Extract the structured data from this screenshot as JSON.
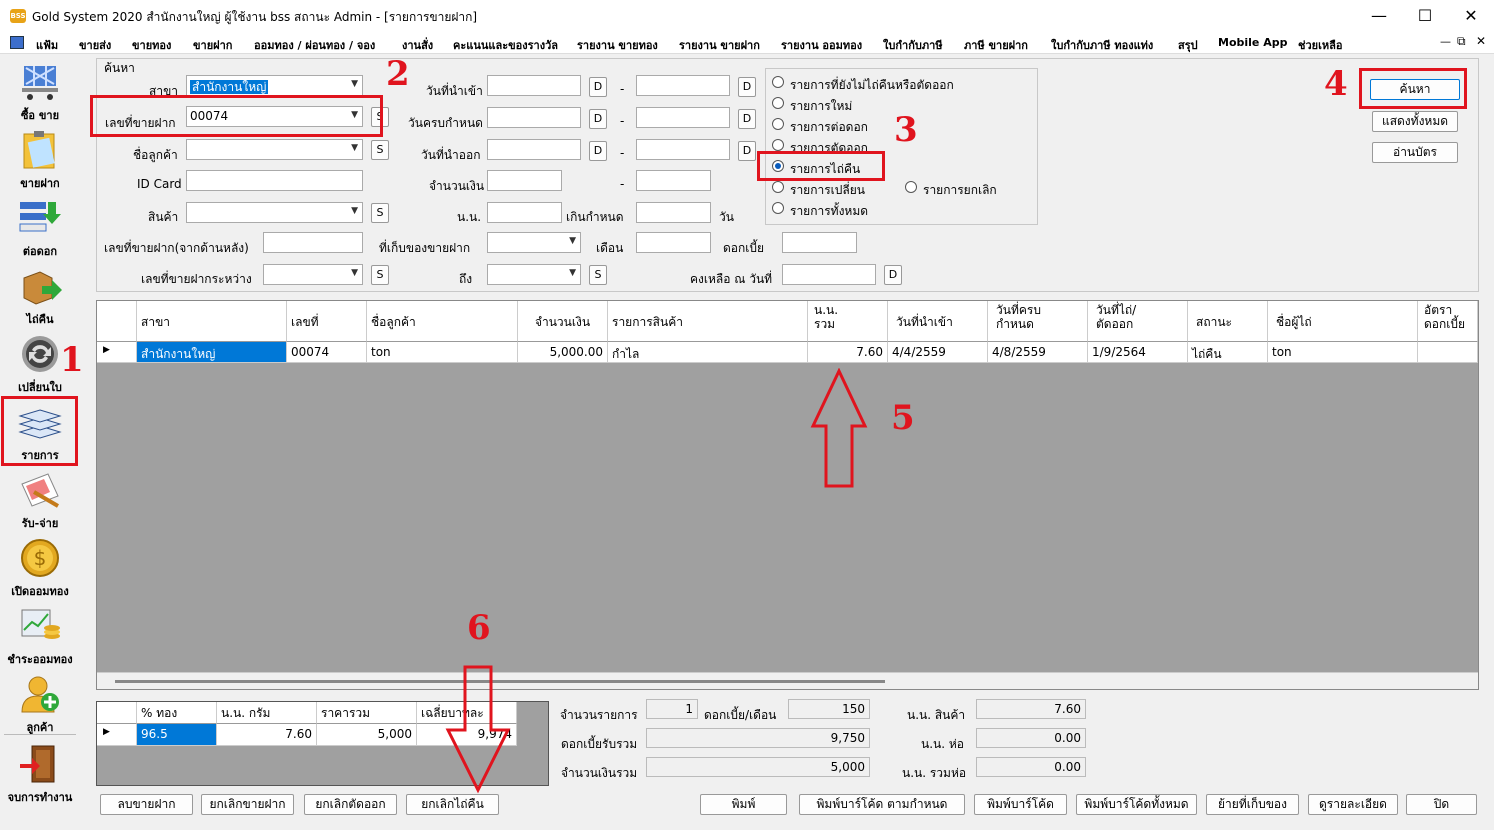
{
  "window": {
    "title": "Gold System 2020  สำนักงานใหญ่ ผู้ใช้งาน bss สถานะ Admin - [รายการขายฝาก]",
    "logo": "BSS",
    "min": "—",
    "max": "☐",
    "close": "✕"
  },
  "menu": [
    "แฟ้ม",
    "ขายส่ง",
    "ขายทอง",
    "ขายฝาก",
    "ออมทอง / ผ่อนทอง / จอง",
    "งานสั่ง",
    "คะแนนและของรางวัล",
    "รายงาน ขายทอง",
    "รายงาน ขายฝาก",
    "รายงาน ออมทอง",
    "ใบกำกับภาษี",
    "ภาษี ขายฝาก",
    "ใบกำกับภาษี ทองแท่ง",
    "สรุป",
    "Mobile App",
    "ช่วยเหลือ"
  ],
  "menu_controls": {
    "min": "—",
    "restore": "⧉",
    "close": "✕"
  },
  "sidebar": [
    "ซื้อ ขาย",
    "ขายฝาก",
    "ต่อดอก",
    "ไถ่คืน",
    "เปลี่ยนใบ",
    "รายการ",
    "รับ-จ่าย",
    "เปิดออมทอง",
    "ชำระออมทอง",
    "ลูกค้า",
    "จบการทำงาน"
  ],
  "search": {
    "group_label": "ค้นหา",
    "branch_label": "สาขา",
    "branch_value": "สำนักงานใหญ่",
    "pawn_no_label": "เลขที่ขายฝาก",
    "pawn_no_value": "00074",
    "customer_label": "ชื่อลูกค้า",
    "customer_value": "",
    "idcard_label": "ID Card",
    "idcard_value": "",
    "product_label": "สินค้า",
    "product_value": "",
    "back_no_label": "เลขที่ขายฝาก(จากด้านหลัง)",
    "range_label": "เลขที่ขายฝากระหว่าง",
    "date_in_label": "วันที่นำเข้า",
    "due_label": "วันครบกำหนด",
    "date_out_label": "วันที่นำออก",
    "amount_label": "จำนวนเงิน",
    "weight_label": "น.น.",
    "over_due_label": "เกินกำหนด",
    "day_unit": "วัน",
    "storage_label": "ที่เก็บของขายฝาก",
    "month_label": "เดือน",
    "interest_label": "ดอกเบี้ย",
    "to_label": "ถึง",
    "balance_label": "คงเหลือ ณ วันที่",
    "dash": "-",
    "s_btn": "S",
    "d_btn": "D"
  },
  "filters": {
    "options": [
      "รายการที่ยังไม่ไถ่คืนหรือตัดออก",
      "รายการใหม่",
      "รายการต่อดอก",
      "รายการตัดออก",
      "รายการไถ่คืน",
      "รายการเปลี่ยน",
      "รายการทั้งหมด"
    ],
    "cancel_option": "รายการยกเลิก",
    "selected": "รายการไถ่คืน"
  },
  "actions": {
    "search": "ค้นหา",
    "show_all": "แสดงทั้งหมด",
    "read_card": "อ่านบัตร"
  },
  "main_grid": {
    "columns": [
      "สาขา",
      "เลขที่",
      "ชื่อลูกค้า",
      "จำนวนเงิน",
      "รายการสินค้า",
      "น.น.\nรวม",
      "วันที่นำเข้า",
      "วันที่ครบ\nกำหนด",
      "วันที่ไถ่/\nตัดออก",
      "สถานะ",
      "ชื่อผู้ไถ่",
      "อัตรา\nดอกเบี้ย"
    ],
    "rows": [
      [
        "สำนักงานใหญ่",
        "00074",
        "ton",
        "5,000.00",
        "กำไล",
        "7.60",
        "4/4/2559",
        "4/8/2559",
        "1/9/2564",
        "ไถ่คืน",
        "ton",
        ""
      ]
    ],
    "row_marker": "▶"
  },
  "sub_grid": {
    "columns": [
      "% ทอง",
      "น.น. กรัม",
      "ราคารวม",
      "เฉลี่ยบาทละ"
    ],
    "rows": [
      [
        "96.5",
        "7.60",
        "5,000",
        "9,974"
      ]
    ]
  },
  "summary": {
    "count_label": "จำนวนรายการ",
    "count_value": "1",
    "interest_month_label": "ดอกเบี้ย/เดือน",
    "interest_month_value": "150",
    "interest_total_label": "ดอกเบี้ยรับรวม",
    "interest_total_value": "9,750",
    "amount_total_label": "จำนวนเงินรวม",
    "amount_total_value": "5,000",
    "product_weight_label": "น.น. สินค้า",
    "product_weight_value": "7.60",
    "pack_weight_label": "น.น. ห่อ",
    "pack_weight_value": "0.00",
    "total_pack_label": "น.น. รวมห่อ",
    "total_pack_value": "0.00"
  },
  "bottom_buttons": [
    "ลบขายฝาก",
    "ยกเลิกขายฝาก",
    "ยกเลิกตัดออก",
    "ยกเลิกไถ่คืน",
    "พิมพ์",
    "พิมพ์บาร์โค้ด ตามกำหนด",
    "พิมพ์บาร์โค้ด",
    "พิมพ์บาร์โค้ดทั้งหมด",
    "ย้ายที่เก็บของ",
    "ดูรายละเอียด",
    "ปิด"
  ],
  "annotations": [
    "1",
    "2",
    "3",
    "4",
    "5",
    "6"
  ],
  "colors": {
    "annotation": "#e0141e",
    "selection": "#0078d7",
    "grid_bg": "#a0a0a0"
  }
}
